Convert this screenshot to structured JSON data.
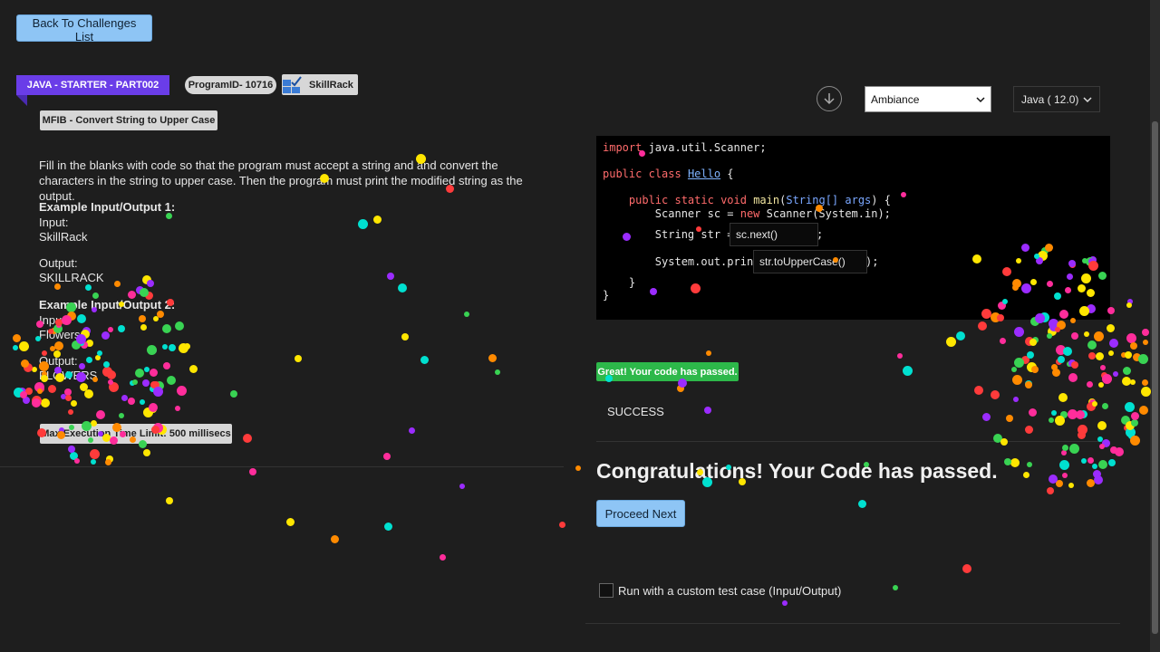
{
  "nav": {
    "back_label": "Back To Challenges List"
  },
  "problem": {
    "track_label": "JAVA - STARTER - PART002",
    "program_id": "ProgramID- 10716",
    "brand": "SkillRack",
    "title": "MFIB - Convert String to Upper Case",
    "description": "Fill in the blanks with code so that the program must accept a string and and convert the characters in the string to upper case. Then the program must print the modified string as the output.",
    "example1_heading": "Example Input/Output 1:",
    "example1_input_label": "Input:",
    "example1_input": "SkillRack",
    "example1_output_label": "Output:",
    "example1_output": "SKILLRACK",
    "example2_heading": "Example Input/Output 2:",
    "example2_input_label": "Input:",
    "example2_input": "Flowers",
    "example2_output_label": "Output:",
    "example2_output": "FLOWERS",
    "time_limit": "Max Execution Time Limit: 500 millisecs"
  },
  "editor": {
    "theme": "Ambiance",
    "language": "Java ( 12.0)",
    "blank1": "sc.next()",
    "blank2": "str.toUpperCase()",
    "colors": {
      "background": "#000000",
      "keyword": "#ff6b6b",
      "type": "#7aa7ff"
    }
  },
  "result": {
    "badge": "Great! Your code has passed.",
    "status": "SUCCESS",
    "congrats": "Congratulations! Your Code has passed.",
    "proceed_label": "Proceed Next",
    "custom_label": "Run with a custom test case (Input/Output)"
  },
  "icons": {
    "download": "download-circle-icon",
    "chevron": "chevron-down-icon"
  },
  "colors": {
    "accent_purple": "#6a3de8",
    "button_blue": "#8ec5f5",
    "success_green": "#2db84a"
  }
}
